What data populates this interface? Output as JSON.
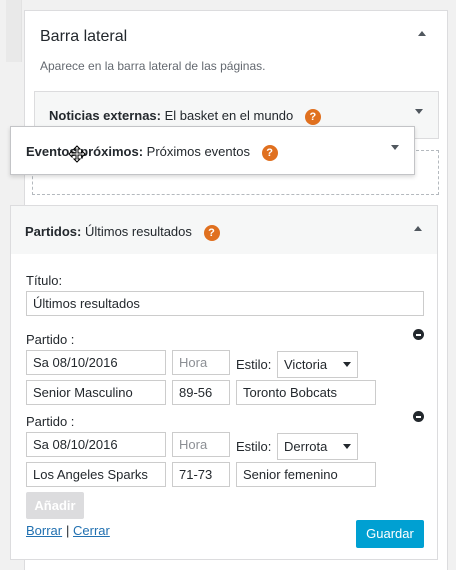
{
  "sidebar_section": {
    "title": "Barra lateral",
    "description": "Aparece en la barra lateral de las páginas."
  },
  "widgets": {
    "news": {
      "type_label": "Noticias externas:",
      "name": "El basket en el mundo"
    },
    "upcoming": {
      "type_label": "Eventos próximos:",
      "name": "Próximos eventos"
    },
    "matches": {
      "type_label": "Partidos:",
      "name": "Últimos resultados"
    }
  },
  "form": {
    "title_label": "Título:",
    "title_value": "Últimos resultados",
    "matches": [
      {
        "label": "Partido :",
        "date": "Sa 08/10/2016",
        "time_placeholder": "Hora",
        "style_label": "Estilo:",
        "style_value": "Victoria",
        "team": "Senior Masculino",
        "score": "89-56",
        "opponent": "Toronto Bobcats"
      },
      {
        "label": "Partido :",
        "date": "Sa 08/10/2016",
        "time_placeholder": "Hora",
        "style_label": "Estilo:",
        "style_value": "Derrota",
        "team": "Los Angeles Sparks",
        "score": "71-73",
        "opponent": "Senior femenino"
      }
    ],
    "add_label": "Añadir",
    "delete_label": "Borrar",
    "separator": "|",
    "close_label": "Cerrar",
    "save_label": "Guardar"
  },
  "icons": {
    "help": "question-mark-icon",
    "remove": "minus-circle-icon",
    "move": "move-cursor-icon"
  },
  "colors": {
    "help": "#e0701f",
    "save": "#00a0d2",
    "link": "#2271b1"
  }
}
